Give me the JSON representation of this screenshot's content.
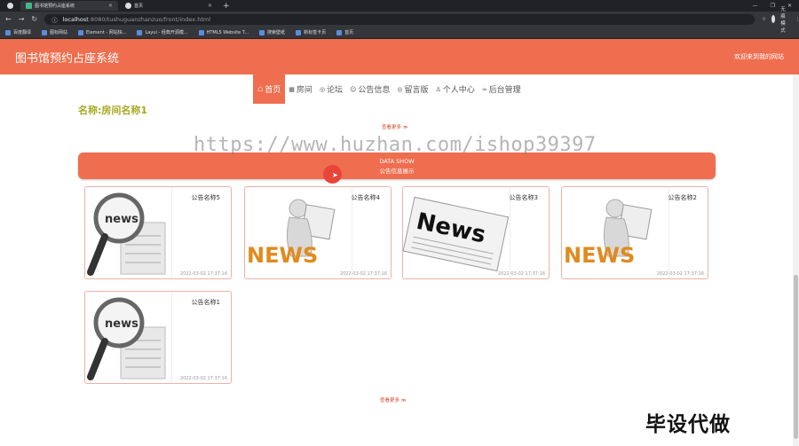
{
  "browser": {
    "tabs": [
      {
        "title": "图书馆预约占座系统",
        "active": true,
        "icon": "vue-icon"
      },
      {
        "title": "首页",
        "active": false,
        "icon": "globe-icon"
      }
    ],
    "new_tab": "+",
    "url_host": "localhost",
    "url_path": ":8080/tushuguanzhanzuo/front/index.html",
    "profile_label": "无痕模式",
    "bookmarks": [
      "百度翻译",
      "图标网站",
      "Element - 网站快...",
      "Layui - 经典开源模...",
      "HTML5 Website T...",
      "搜索壁纸",
      "新标签卡页",
      "首页"
    ]
  },
  "header": {
    "title": "图书馆预约占座系统",
    "welcome": "欢迎来到我的网站"
  },
  "nav": {
    "items": [
      {
        "icon": "home-icon",
        "glyph": "☖",
        "label": "首页",
        "active": true
      },
      {
        "icon": "room-icon",
        "glyph": "▦",
        "label": "房间",
        "active": false
      },
      {
        "icon": "forum-icon",
        "glyph": "◎",
        "label": "论坛",
        "active": false
      },
      {
        "icon": "notice-icon",
        "glyph": "☺",
        "label": "公告信息",
        "active": false
      },
      {
        "icon": "message-icon",
        "glyph": "◎",
        "label": "留言版",
        "active": false
      },
      {
        "icon": "user-icon",
        "glyph": "♙",
        "label": "个人中心",
        "active": false
      },
      {
        "icon": "link-icon",
        "glyph": "∞",
        "label": "后台管理",
        "active": false
      }
    ]
  },
  "room_section": {
    "title": "名称:房间名称1",
    "more": "查看更多 ≫"
  },
  "watermark": "https://www.huzhan.com/ishop39397",
  "datashow": {
    "title": "DATA SHOW",
    "subtitle": "公告信息展示"
  },
  "notices": [
    {
      "name": "公告名称5",
      "time": "2022-03-02 17:37:16",
      "image": "magnifier-news-icon"
    },
    {
      "name": "公告名称4",
      "time": "2022-03-02 17:37:16",
      "image": "figure-news-icon"
    },
    {
      "name": "公告名称3",
      "time": "2022-03-02 17:37:16",
      "image": "newspaper-icon"
    },
    {
      "name": "公告名称2",
      "time": "2022-03-02 17:37:16",
      "image": "figure-news-icon"
    },
    {
      "name": "公告名称1",
      "time": "2022-03-02 17:37:16",
      "image": "magnifier-news-icon"
    }
  ],
  "notice_more": "查看更多 ≫",
  "corner_text": "毕设代做",
  "colors": {
    "accent": "#ef6e4f",
    "title_olive": "#a6a820"
  }
}
